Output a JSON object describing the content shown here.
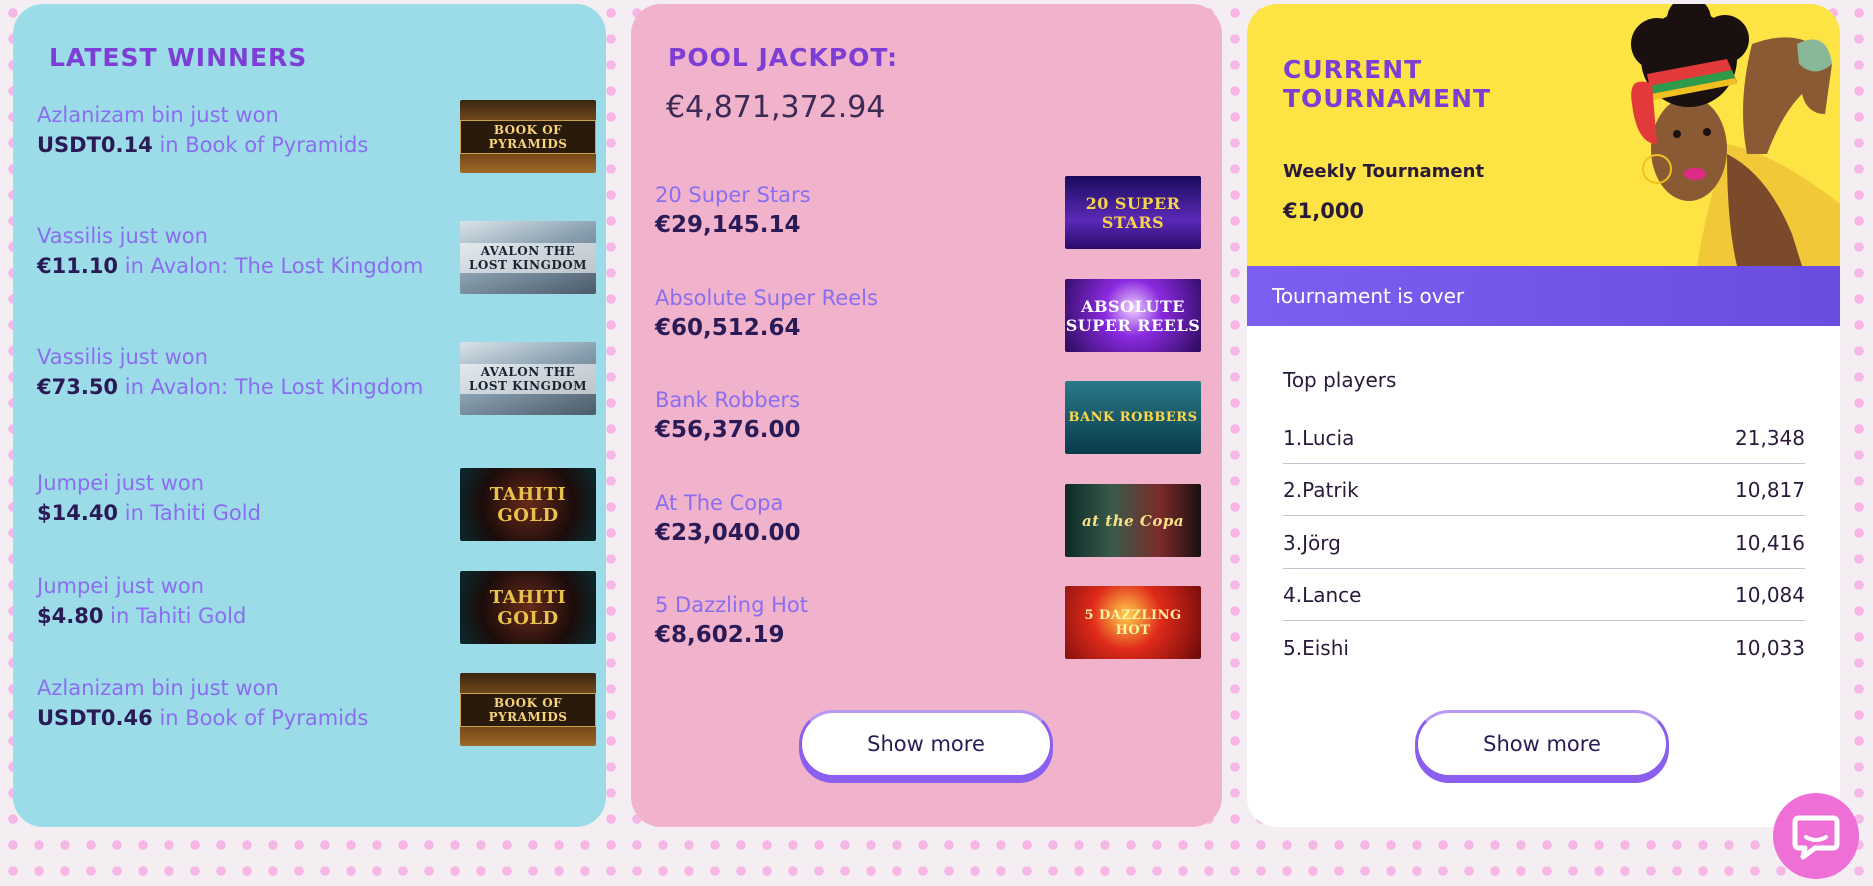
{
  "winners": {
    "title": "LATEST WINNERS",
    "items": [
      {
        "name": "Azlanizam bin",
        "just_won": "just won",
        "amount": "USDT0.14",
        "in_game": "in Book of Pyramids",
        "thumb_text": "BOOK OF PYRAMIDS"
      },
      {
        "name": "Vassilis",
        "just_won": "just won",
        "amount": "€11.10",
        "in_game": "in Avalon: The Lost Kingdom",
        "thumb_text": "AVALON THE LOST KINGDOM"
      },
      {
        "name": "Vassilis",
        "just_won": "just won",
        "amount": "€73.50",
        "in_game": "in Avalon: The Lost Kingdom",
        "thumb_text": "AVALON THE LOST KINGDOM"
      },
      {
        "name": "Jumpei",
        "just_won": "just won",
        "amount": "$14.40",
        "in_game": "in Tahiti Gold",
        "thumb_text": "TAHITI GOLD"
      },
      {
        "name": "Jumpei",
        "just_won": "just won",
        "amount": "$4.80",
        "in_game": "in Tahiti Gold",
        "thumb_text": "TAHITI GOLD"
      },
      {
        "name": "Azlanizam bin",
        "just_won": "just won",
        "amount": "USDT0.46",
        "in_game": "in Book of Pyramids",
        "thumb_text": "BOOK OF PYRAMIDS"
      }
    ]
  },
  "jackpot": {
    "title": "POOL JACKPOT:",
    "total": "€4,871,372.94",
    "items": [
      {
        "name": "20 Super Stars",
        "amount": "€29,145.14",
        "thumb_text": "20 SUPER STARS"
      },
      {
        "name": "Absolute Super Reels",
        "amount": "€60,512.64",
        "thumb_text": "ABSOLUTE SUPER REELS"
      },
      {
        "name": "Bank Robbers",
        "amount": "€56,376.00",
        "thumb_text": "BANK ROBBERS"
      },
      {
        "name": "At The Copa",
        "amount": "€23,040.00",
        "thumb_text": "at the Copa"
      },
      {
        "name": "5 Dazzling Hot",
        "amount": "€8,602.19",
        "thumb_text": "5 DAZZLING HOT"
      }
    ],
    "show_more": "Show more"
  },
  "tournament": {
    "title": "CURRENT TOURNAMENT",
    "name": "Weekly Tournament",
    "prize": "€1,000",
    "status": "Tournament is over",
    "top_players_label": "Top players",
    "players": [
      {
        "rank_name": "1.Lucia",
        "score": "21,348"
      },
      {
        "rank_name": "2.Patrik",
        "score": "10,817"
      },
      {
        "rank_name": "3.Jörg",
        "score": "10,416"
      },
      {
        "rank_name": "4.Lance",
        "score": "10,084"
      },
      {
        "rank_name": "5.Eishi",
        "score": "10,033"
      }
    ],
    "show_more": "Show more"
  },
  "chat": {
    "icon": "chat-bubble-icon"
  },
  "colors": {
    "winners_bg": "#9cdbe8",
    "jackpot_bg": "#f1b3cb",
    "tournament_header_bg": "#fde444",
    "status_bar": "#7c5ef0",
    "title_purple": "#7d3ed6",
    "link_purple": "#8a6ef0",
    "chat_pink": "#ee6fd6"
  }
}
